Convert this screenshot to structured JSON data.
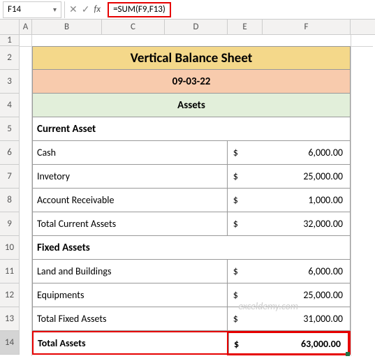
{
  "cellref": "F14",
  "formula": "=SUM(F9,F13)",
  "cols": [
    "A",
    "B",
    "C",
    "D",
    "E",
    "F"
  ],
  "rows": [
    "1",
    "2",
    "3",
    "4",
    "5",
    "6",
    "7",
    "8",
    "9",
    "10",
    "11",
    "12",
    "13",
    "14"
  ],
  "sheet": {
    "title": "Vertical Balance Sheet",
    "date": "09-03-22",
    "section": "Assets",
    "current_hdr": "Current Asset",
    "items_current": [
      {
        "label": "Cash",
        "sym": "$",
        "val": "6,000.00"
      },
      {
        "label": "Invetory",
        "sym": "$",
        "val": "25,000.00"
      },
      {
        "label": "Account Receivable",
        "sym": "$",
        "val": "1,000.00"
      },
      {
        "label": "Total Current Assets",
        "sym": "$",
        "val": "32,000.00"
      }
    ],
    "fixed_hdr": "Fixed Assets",
    "items_fixed": [
      {
        "label": "Land and Buildings",
        "sym": "$",
        "val": "6,000.00"
      },
      {
        "label": "Equipments",
        "sym": "$",
        "val": "25,000.00"
      },
      {
        "label": "Total Fixed Assets",
        "sym": "$",
        "val": "31,000.00"
      }
    ],
    "total_label": "Total Assets",
    "total_sym": "$",
    "total_val": "63,000.00"
  },
  "watermark": "exceldemy.com"
}
